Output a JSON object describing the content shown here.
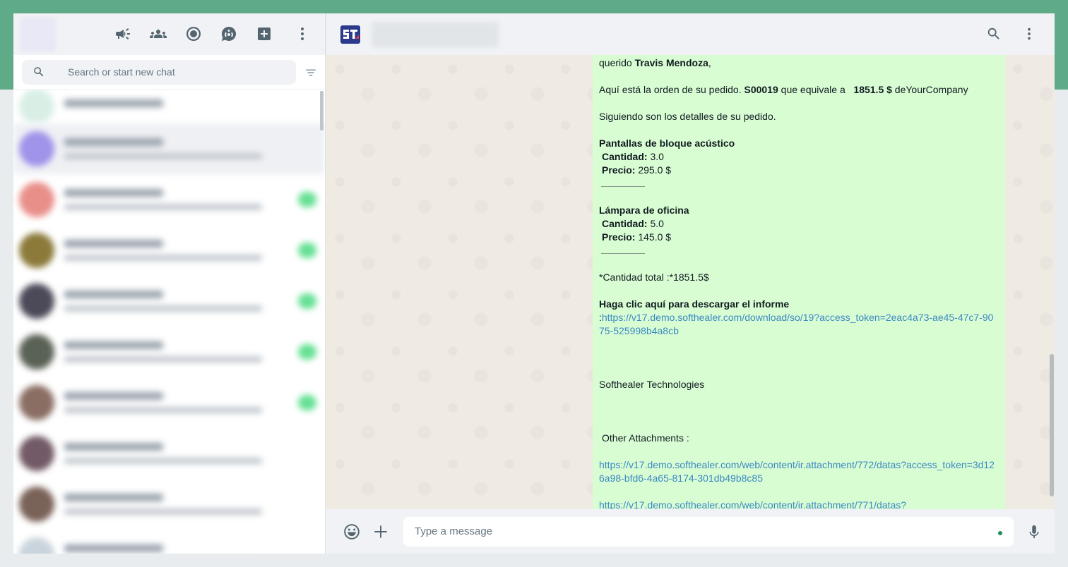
{
  "sidebar": {
    "search": {
      "placeholder": "Search or start new chat"
    },
    "icons": [
      "communities-megaphone-icon",
      "communities-icon",
      "status-icon",
      "channels-icon",
      "new-chat-icon",
      "menu-icon"
    ],
    "chats": [
      {
        "avatar": "#d9efe6",
        "badge": false
      },
      {
        "avatar": "#9f93ea",
        "badge": false,
        "selected": true
      },
      {
        "avatar": "#e98f8a",
        "badge": true
      },
      {
        "avatar": "#8b7a3a",
        "badge": true
      },
      {
        "avatar": "#4c4a58",
        "badge": true
      },
      {
        "avatar": "#5a6256",
        "badge": true
      },
      {
        "avatar": "#8a6e64",
        "badge": true
      },
      {
        "avatar": "#725a66",
        "badge": false
      },
      {
        "avatar": "#7a6258",
        "badge": false
      },
      {
        "avatar": "#c9d4dc",
        "badge": false
      }
    ]
  },
  "message": {
    "greeting_prefix": "querido ",
    "customer": "Travis Mendoza",
    "greeting_suffix": ",",
    "order_line_prefix": "Aquí está la orden de su pedido. ",
    "order_ref": "S00019",
    "order_line_mid": " que equivale a   ",
    "order_amount": "1851.5 $",
    "order_line_suffix": " deYourCompany",
    "details_intro": "Siguiendo son los detalles de su pedido.",
    "items": [
      {
        "name": "Pantallas de bloque acústico",
        "qty_label": "Cantidad:",
        "qty": " 3.0",
        "price_label": "Precio:",
        "price": " 295.0 $"
      },
      {
        "name": "Lámpara de oficina",
        "qty_label": "Cantidad:",
        "qty": " 5.0",
        "price_label": "Precio:",
        "price": " 145.0 $"
      }
    ],
    "total": "*Cantidad total :*1851.5$",
    "download_label": "Haga clic aquí para descargar el informe",
    "download_prefix": ":",
    "download_link": "https://v17.demo.softhealer.com/download/so/19?access_token=2eac4a73-ae45-47c7-9075-525998b4a8cb",
    "signature": "Softhealer Technologies",
    "attachments_label": "Other Attachments :",
    "attachments": [
      "https://v17.demo.softhealer.com/web/content/ir.attachment/772/datas?access_token=3d126a98-bfd6-4a65-8174-301db49b8c85",
      "https://v17.demo.softhealer.com/web/content/ir.attachment/771/datas?"
    ]
  },
  "composer": {
    "placeholder": "Type a message"
  },
  "colors": {
    "bubble": "#d9fdd3",
    "link": "#3b88c3",
    "top_band": "#5fab88"
  }
}
